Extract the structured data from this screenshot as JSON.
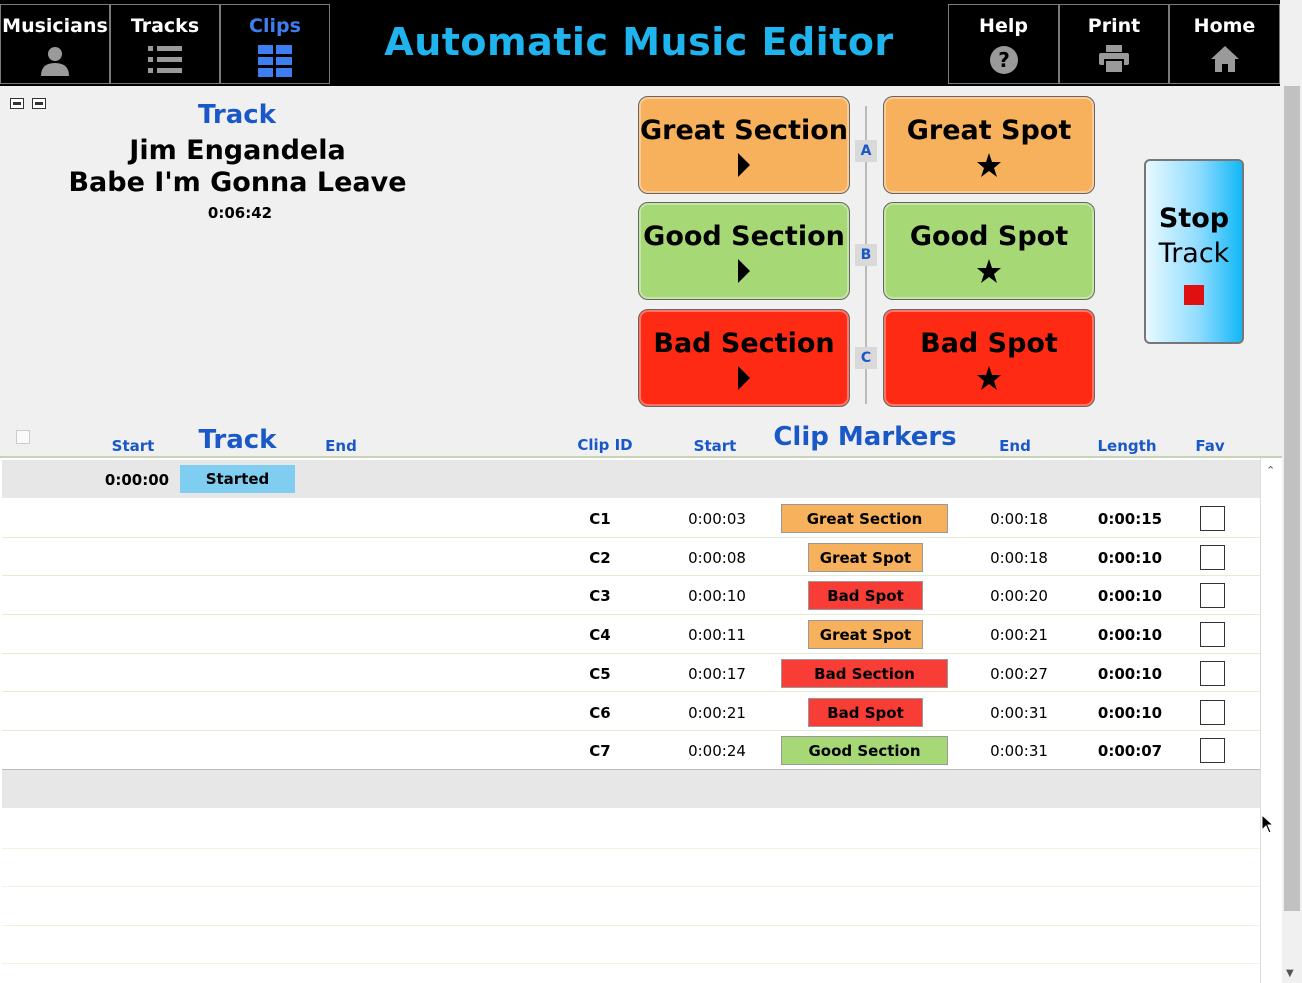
{
  "nav": {
    "musicians": "Musicians",
    "tracks": "Tracks",
    "clips": "Clips",
    "help": "Help",
    "print": "Print",
    "home": "Home",
    "active_color": "#3d7ef0"
  },
  "app_title": "Automatic Music Editor",
  "track": {
    "heading": "Track",
    "artist": "Jim Engandela",
    "title": "Babe I'm Gonna Leave",
    "duration": "0:06:42"
  },
  "markers": {
    "great_section": "Great Section",
    "great_spot": "Great Spot",
    "good_section": "Good Section",
    "good_spot": "Good Spot",
    "bad_section": "Bad Section",
    "bad_spot": "Bad Spot",
    "row_keys": [
      "A",
      "B",
      "C"
    ],
    "colors": {
      "great": "#f7b05b",
      "good": "#a6d876",
      "bad": "#fe2a13"
    }
  },
  "stop_button": {
    "line1": "Stop",
    "line2": "Track"
  },
  "table_headers": {
    "start": "Start",
    "track": "Track",
    "end": "End",
    "clip_id": "Clip ID",
    "clip_start": "Start",
    "clip_markers": "Clip Markers",
    "clip_end": "End",
    "length": "Length",
    "fav": "Fav"
  },
  "started_row": {
    "time": "0:00:00",
    "status": "Started"
  },
  "clips": [
    {
      "id": "C1",
      "start": "0:00:03",
      "marker": "Great Section",
      "end": "0:00:18",
      "length": "0:00:15"
    },
    {
      "id": "C2",
      "start": "0:00:08",
      "marker": "Great Spot",
      "end": "0:00:18",
      "length": "0:00:10"
    },
    {
      "id": "C3",
      "start": "0:00:10",
      "marker": "Bad Spot",
      "end": "0:00:20",
      "length": "0:00:10"
    },
    {
      "id": "C4",
      "start": "0:00:11",
      "marker": "Great Spot",
      "end": "0:00:21",
      "length": "0:00:10"
    },
    {
      "id": "C5",
      "start": "0:00:17",
      "marker": "Bad Section",
      "end": "0:00:27",
      "length": "0:00:10"
    },
    {
      "id": "C6",
      "start": "0:00:21",
      "marker": "Bad Spot",
      "end": "0:00:31",
      "length": "0:00:10"
    },
    {
      "id": "C7",
      "start": "0:00:24",
      "marker": "Good Section",
      "end": "0:00:31",
      "length": "0:00:07"
    }
  ]
}
